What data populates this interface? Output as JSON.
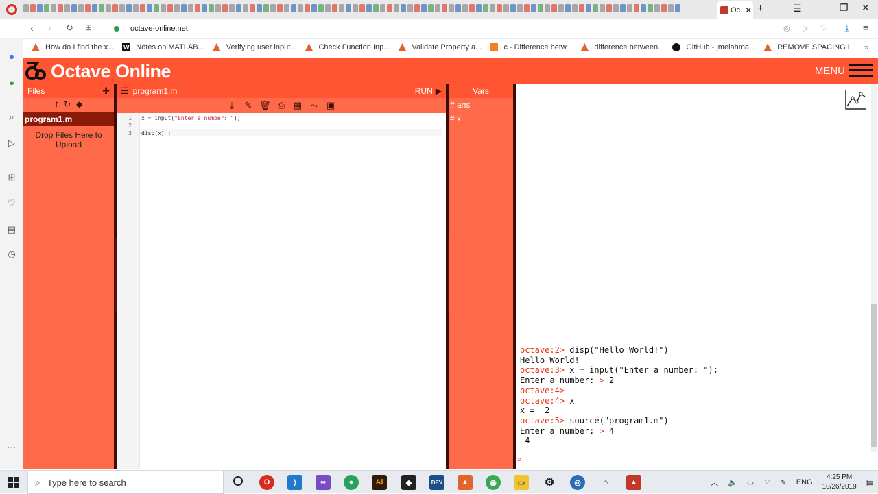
{
  "browser": {
    "url": "octave-online.net",
    "active_tab_label": "Oc",
    "bookmarks": [
      "How do I find the x...",
      "Notes on MATLAB...",
      "Verifying user input...",
      "Check Function Inp...",
      "Validate Property a...",
      "c - Difference betw...",
      "difference between...",
      "GitHub - jmelahma...",
      "REMOVE SPACING I..."
    ]
  },
  "app": {
    "logo_text": "Octave Online",
    "menu_label": "MENU"
  },
  "files_panel": {
    "title": "Files",
    "file_name": "program1.m",
    "drop_text": "Drop Files Here to Upload"
  },
  "editor": {
    "file_title": "program1.m",
    "run_label": "RUN",
    "line_numbers": [
      "1",
      "2",
      "3"
    ],
    "lines": [
      {
        "pre": "x = input(",
        "str": "\"Enter a number: \"",
        "post": ");"
      },
      {
        "pre": "",
        "str": "",
        "post": ""
      },
      {
        "pre": "disp(x) ;",
        "str": "",
        "post": ""
      }
    ]
  },
  "vars_panel": {
    "title": "Vars",
    "items": [
      "# ans",
      "# x"
    ]
  },
  "console": {
    "lines": [
      {
        "prompt": "octave:2> ",
        "text": "disp(\"Hello World!\")"
      },
      {
        "prompt": "",
        "text": "Hello World!"
      },
      {
        "prompt": "octave:3> ",
        "text": "x = input(\"Enter a number: \");"
      },
      {
        "prompt": "",
        "text": "Enter a number: ",
        "input_mark": "> ",
        "after": "2"
      },
      {
        "prompt": "octave:4> ",
        "text": ""
      },
      {
        "prompt": "octave:4> ",
        "text": "x"
      },
      {
        "prompt": "",
        "text": "x =  2"
      },
      {
        "prompt": "octave:5> ",
        "text": "source(\"program1.m\")"
      },
      {
        "prompt": "",
        "text": "Enter a number: ",
        "input_mark": "> ",
        "after": "4"
      },
      {
        "prompt": "",
        "text": " 4"
      }
    ]
  },
  "taskbar": {
    "search_placeholder": "Type here to search",
    "language": "ENG",
    "time": "4:25 PM",
    "date": "10/26/2019"
  },
  "colors": {
    "octave_orange": "#ff5533",
    "panel_orange": "#ff6a4a",
    "dark_red": "#8b1a08",
    "prompt_red": "#e8351c"
  }
}
